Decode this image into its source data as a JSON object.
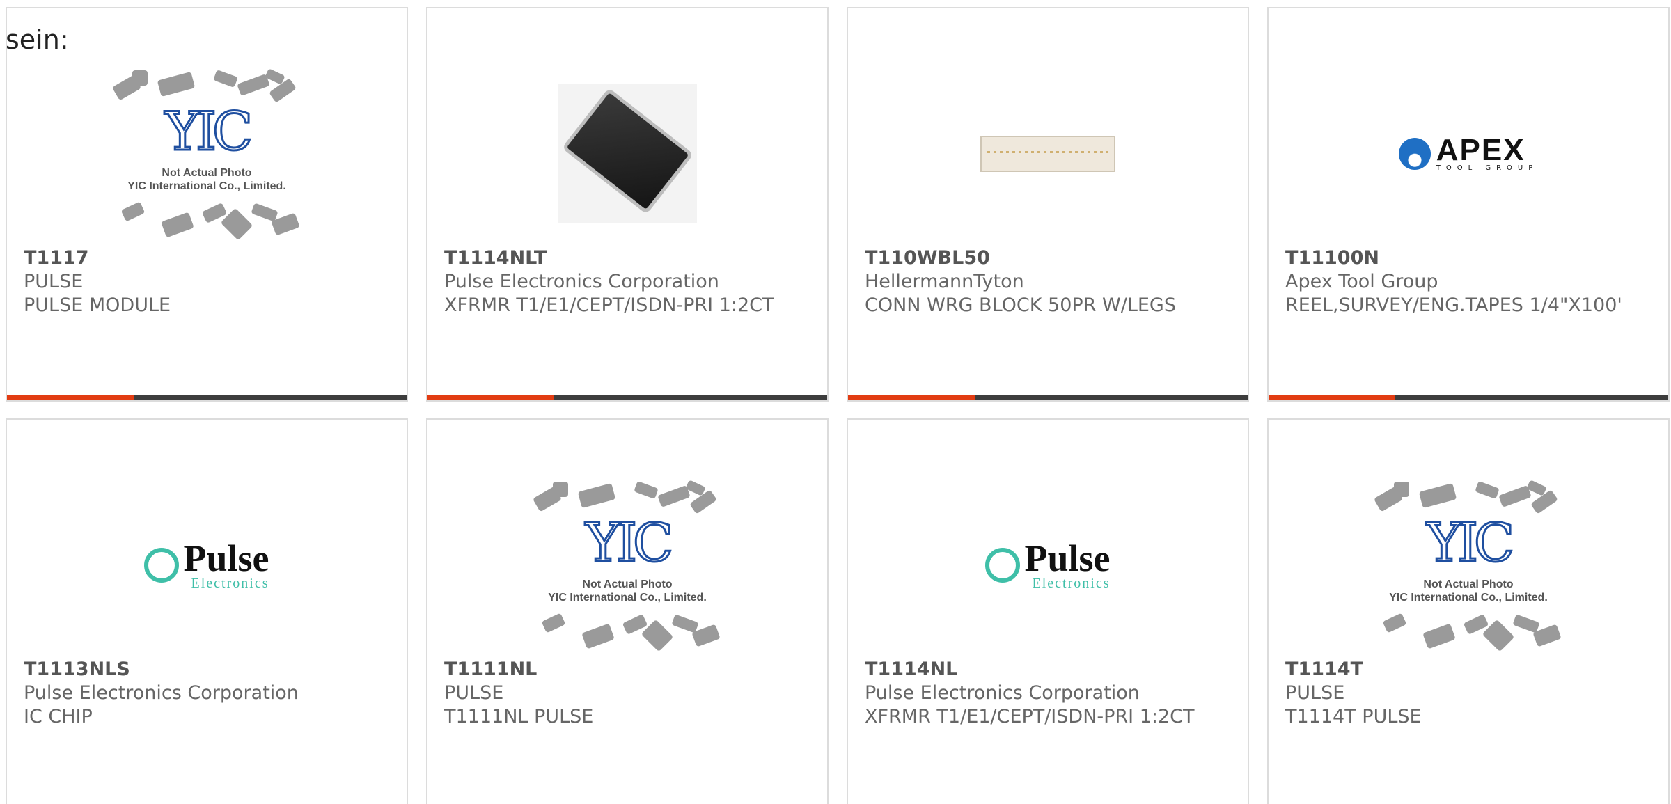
{
  "intro_text": "sein:",
  "colors": {
    "accent": "#e23c12",
    "bar": "#3d3d3d",
    "text": "#666666",
    "border": "#dcdcdc"
  },
  "cards": [
    {
      "part_number": "T1117",
      "manufacturer": "PULSE",
      "description": "PULSE MODULE",
      "image": "yic-placeholder",
      "image_caption": "Not Actual Photo\nYIC International Co., Limited."
    },
    {
      "part_number": "T1114NLT",
      "manufacturer": "Pulse Electronics Corporation",
      "description": "XFRMR T1/E1/CEPT/ISDN-PRI 1:2CT",
      "image": "ic-chip-photo"
    },
    {
      "part_number": "T110WBL50",
      "manufacturer": "HellermannTyton",
      "description": "CONN WRG BLOCK 50PR W/LEGS",
      "image": "connector-block-photo"
    },
    {
      "part_number": "T11100N",
      "manufacturer": "Apex Tool Group",
      "description": "REEL,SURVEY/ENG.TAPES 1/4\"X100'",
      "image": "apex-logo",
      "logo_text": "APEX",
      "logo_subtext": "TOOL GROUP"
    },
    {
      "part_number": "T1113NLS",
      "manufacturer": "Pulse Electronics Corporation",
      "description": "IC CHIP",
      "image": "pulse-logo",
      "logo_text": "Pulse",
      "logo_subtext": "Electronics"
    },
    {
      "part_number": "T1111NL",
      "manufacturer": "PULSE",
      "description": "T1111NL PULSE",
      "image": "yic-placeholder",
      "image_caption": "Not Actual Photo\nYIC International Co., Limited."
    },
    {
      "part_number": "T1114NL",
      "manufacturer": "Pulse Electronics Corporation",
      "description": "XFRMR T1/E1/CEPT/ISDN-PRI 1:2CT",
      "image": "pulse-logo",
      "logo_text": "Pulse",
      "logo_subtext": "Electronics"
    },
    {
      "part_number": "T1114T",
      "manufacturer": "PULSE",
      "description": "T1114T PULSE",
      "image": "yic-placeholder",
      "image_caption": "Not Actual Photo\nYIC International Co., Limited."
    }
  ]
}
